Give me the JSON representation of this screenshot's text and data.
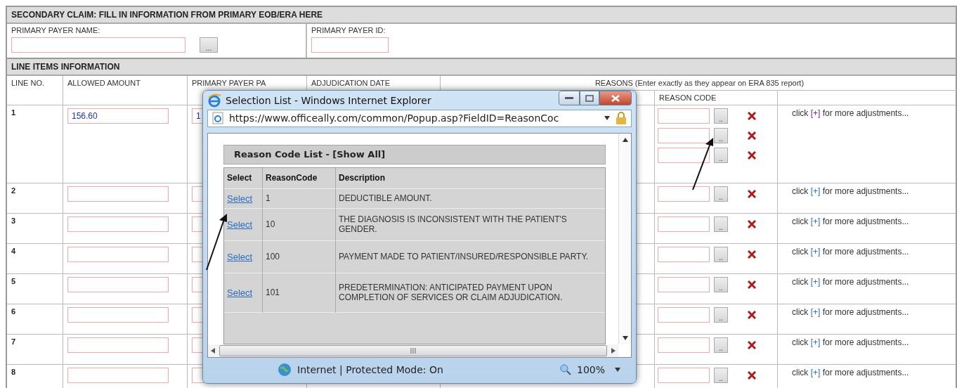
{
  "form": {
    "title": "SECONDARY CLAIM: FILL IN INFORMATION FROM PRIMARY EOB/ERA HERE",
    "payer_name_label": "PRIMARY PAYER NAME:",
    "payer_lookup": "...",
    "payer_id_label": "PRIMARY PAYER ID:"
  },
  "line_items": {
    "title": "LINE ITEMS INFORMATION",
    "columns": [
      "LINE NO.",
      "ALLOWED AMOUNT",
      "PRIMARY PAYER PA",
      "ADJUDICATION DATE"
    ],
    "reasons_header": "REASONS (Enter exactly as they appear on ERA 835 report)",
    "reason_code_header": "REASON CODE",
    "rows": [
      {
        "line": "1",
        "allowed_amount": "156.60",
        "payer_paid": "1",
        "reasons": [
          {
            "lookup": ".."
          },
          {
            "lookup": ".."
          },
          {
            "lookup": ".."
          }
        ],
        "more": {
          "before": "click",
          "link": "[+]",
          "after": "for more adjustments...",
          "visited": true
        }
      },
      {
        "line": "2",
        "reasons": [
          {
            "lookup": ".."
          }
        ],
        "more": {
          "before": "click",
          "link": "[+]",
          "after": "for more adjustments...",
          "visited": false
        }
      },
      {
        "line": "3",
        "reasons": [
          {
            "lookup": ".."
          }
        ],
        "more": {
          "before": "click",
          "link": "[+]",
          "after": "for more adjustments...",
          "visited": false
        }
      },
      {
        "line": "4",
        "reasons": [
          {
            "lookup": ".."
          }
        ],
        "more": {
          "before": "click",
          "link": "[+]",
          "after": "for more adjustments...",
          "visited": false
        }
      },
      {
        "line": "5",
        "reasons": [
          {
            "lookup": ".."
          }
        ],
        "more": {
          "before": "click",
          "link": "[+]",
          "after": "for more adjustments...",
          "visited": false
        }
      },
      {
        "line": "6",
        "reasons": [
          {
            "lookup": ".."
          }
        ],
        "more": {
          "before": "click",
          "link": "[+]",
          "after": "for more adjustments...",
          "visited": false
        }
      },
      {
        "line": "7",
        "reasons": [
          {
            "lookup": ".."
          }
        ],
        "more": {
          "before": "click",
          "link": "[+]",
          "after": "for more adjustments...",
          "visited": false
        }
      },
      {
        "line": "8",
        "reasons": [
          {
            "lookup": ".."
          }
        ],
        "more": {
          "before": "click",
          "link": "[+]",
          "after": "for more adjustments...",
          "visited": false
        }
      }
    ]
  },
  "popup": {
    "title": "Selection List - Windows Internet Explorer",
    "address": "https://www.officeally.com/common/Popup.asp?FieldID=ReasonCoc",
    "list_title": "Reason Code List - [Show All]",
    "columns": [
      "Select",
      "ReasonCode",
      "Description"
    ],
    "rows": [
      {
        "select": "Select",
        "code": "1",
        "description": "DEDUCTIBLE AMOUNT."
      },
      {
        "select": "Select",
        "code": "10",
        "description": "THE DIAGNOSIS IS INCONSISTENT WITH THE PATIENT'S GENDER."
      },
      {
        "select": "Select",
        "code": "100",
        "description": "PAYMENT MADE TO PATIENT/INSURED/RESPONSIBLE PARTY."
      },
      {
        "select": "Select",
        "code": "101",
        "description": "PREDETERMINATION: ANTICIPATED PAYMENT UPON COMPLETION OF SERVICES OR CLAIM ADJUDICATION."
      }
    ],
    "status": "Internet | Protected Mode: On",
    "zoom": "100%"
  }
}
